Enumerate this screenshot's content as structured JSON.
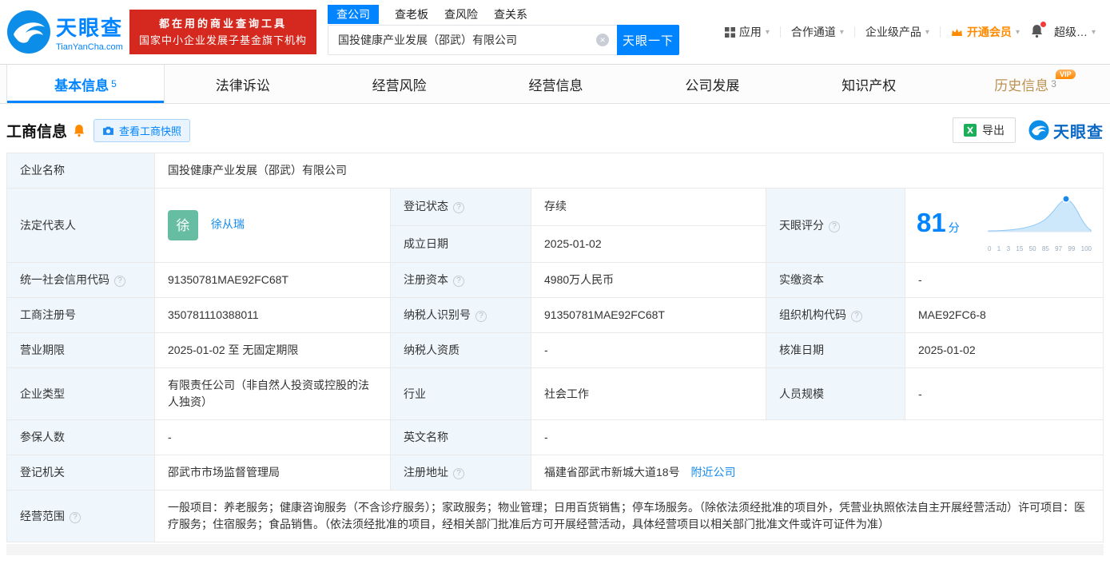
{
  "header": {
    "brand": "天眼查",
    "domain": "TianYanCha.com",
    "slogan1": "都在用的商业查询工具",
    "slogan2": "国家中小企业发展子基金旗下机构",
    "search_tabs": [
      "查公司",
      "查老板",
      "查风险",
      "查关系"
    ],
    "search_value": "国投健康产业发展（邵武）有限公司",
    "search_button": "天眼一下",
    "nav": {
      "apps": "应用",
      "partner": "合作通道",
      "enterprise": "企业级产品",
      "vip": "开通会员",
      "super": "超级…"
    }
  },
  "tabs": [
    {
      "label": "基本信息",
      "count": "5"
    },
    {
      "label": "法律诉讼",
      "count": ""
    },
    {
      "label": "经营风险",
      "count": ""
    },
    {
      "label": "经营信息",
      "count": ""
    },
    {
      "label": "公司发展",
      "count": ""
    },
    {
      "label": "知识产权",
      "count": ""
    },
    {
      "label": "历史信息",
      "count": "3",
      "vip": "VIP"
    }
  ],
  "section": {
    "title": "工商信息",
    "snapshot_button": "查看工商快照",
    "export_button": "导出",
    "brand": "天眼查"
  },
  "info": {
    "enterprise_name": {
      "label": "企业名称",
      "value": "国投健康产业发展（邵武）有限公司"
    },
    "legal_rep": {
      "label": "法定代表人",
      "avatar": "徐",
      "name": "徐从瑞"
    },
    "reg_status": {
      "label": "登记状态",
      "value": "存续"
    },
    "establish_date": {
      "label": "成立日期",
      "value": "2025-01-02"
    },
    "score": {
      "label": "天眼评分",
      "value": "81",
      "unit": "分",
      "axis": [
        "0",
        "1",
        "3",
        "15",
        "50",
        "85",
        "97",
        "99",
        "100"
      ]
    },
    "credit_code": {
      "label": "统一社会信用代码",
      "value": "91350781MAE92FC68T"
    },
    "reg_capital": {
      "label": "注册资本",
      "value": "4980万人民币"
    },
    "paid_capital": {
      "label": "实缴资本",
      "value": "-"
    },
    "reg_number": {
      "label": "工商注册号",
      "value": "350781110388011"
    },
    "taxpayer_id": {
      "label": "纳税人识别号",
      "value": "91350781MAE92FC68T"
    },
    "org_code": {
      "label": "组织机构代码",
      "value": "MAE92FC6-8"
    },
    "business_term": {
      "label": "营业期限",
      "value": "2025-01-02 至 无固定期限"
    },
    "taxpayer_quality": {
      "label": "纳税人资质",
      "value": "-"
    },
    "approval_date": {
      "label": "核准日期",
      "value": "2025-01-02"
    },
    "company_type": {
      "label": "企业类型",
      "value": "有限责任公司（非自然人投资或控股的法人独资）"
    },
    "industry": {
      "label": "行业",
      "value": "社会工作"
    },
    "staff_size": {
      "label": "人员规模",
      "value": "-"
    },
    "insured_count": {
      "label": "参保人数",
      "value": "-"
    },
    "english_name": {
      "label": "英文名称",
      "value": "-"
    },
    "reg_authority": {
      "label": "登记机关",
      "value": "邵武市市场监督管理局"
    },
    "reg_address": {
      "label": "注册地址",
      "value": "福建省邵武市新城大道18号",
      "link": "附近公司"
    },
    "business_scope": {
      "label": "经营范围",
      "value": "一般项目：养老服务；健康咨询服务（不含诊疗服务）；家政服务；物业管理；日用百货销售；停车场服务。（除依法须经批准的项目外，凭营业执照依法自主开展经营活动）许可项目：医疗服务；住宿服务；食品销售。（依法须经批准的项目，经相关部门批准后方可开展经营活动，具体经营项目以相关部门批准文件或许可证件为准）"
    }
  }
}
